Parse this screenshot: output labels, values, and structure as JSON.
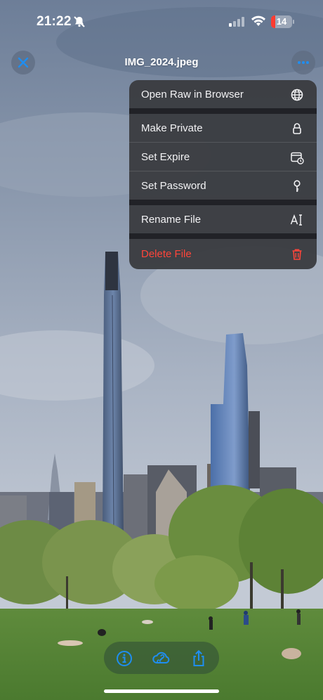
{
  "status_bar": {
    "time": "21:22",
    "battery": "14"
  },
  "header": {
    "title": "IMG_2024.jpeg"
  },
  "menu": {
    "items": [
      {
        "label": "Open Raw in Browser",
        "icon": "globe-icon"
      },
      {
        "label": "Make Private",
        "icon": "lock-icon"
      },
      {
        "label": "Set Expire",
        "icon": "calendar-clock-icon"
      },
      {
        "label": "Set Password",
        "icon": "key-icon"
      },
      {
        "label": "Rename File",
        "icon": "text-cursor-icon"
      },
      {
        "label": "Delete File",
        "icon": "trash-icon"
      }
    ]
  },
  "toolbar": {
    "icons": [
      "info-icon",
      "cloud-link-icon",
      "share-icon"
    ]
  },
  "colors": {
    "accent": "#1f8ef1",
    "danger": "#ff453a",
    "menu_bg": "#3a3c41"
  }
}
